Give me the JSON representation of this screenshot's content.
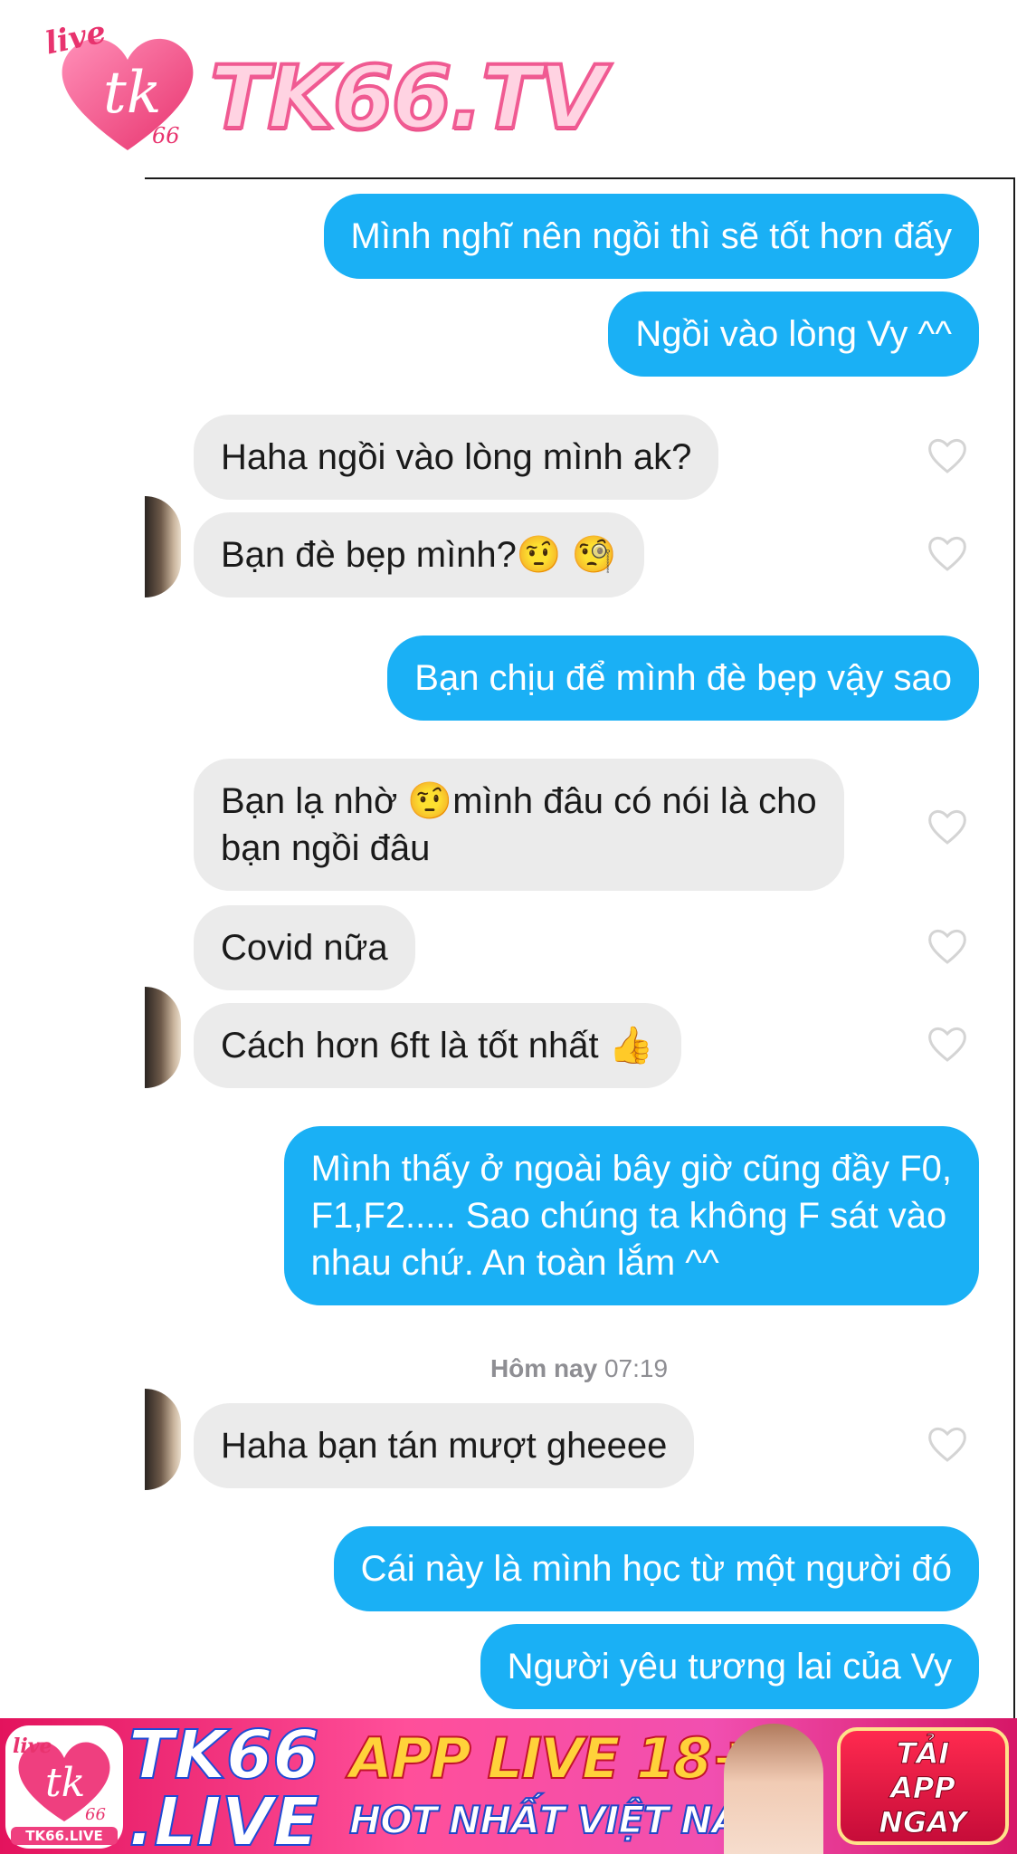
{
  "watermark": {
    "logo_live": "live",
    "logo_mark": "tk",
    "logo_number": "66",
    "brand": "TK66.TV"
  },
  "messages": [
    {
      "id": "m1",
      "side": "out",
      "text": "Mình nghĩ nên ngồi thì sẽ tốt hơn đấy"
    },
    {
      "id": "m2",
      "side": "out",
      "text": "Ngồi vào lòng Vy ^^"
    },
    {
      "id": "m3",
      "side": "in",
      "text": "Haha ngồi vào lòng mình ak?"
    },
    {
      "id": "m4",
      "side": "in",
      "text": "Bạn đè bẹp mình?",
      "emoji": "🤨 🧐"
    },
    {
      "id": "m5",
      "side": "out",
      "text": "Bạn chịu để mình đè bẹp vậy sao"
    },
    {
      "id": "m6",
      "side": "in",
      "line1_before": "Bạn lạ nhờ ",
      "emoji": "🤨",
      "line1_after": "mình đâu có nói là cho",
      "line2": "bạn ngồi đâu"
    },
    {
      "id": "m7",
      "side": "in",
      "text": "Covid nữa"
    },
    {
      "id": "m8",
      "side": "in",
      "text": "Cách hơn 6ft là tốt nhất ",
      "emoji": "👍"
    },
    {
      "id": "m9",
      "side": "out",
      "lines": [
        "Mình thấy ở ngoài bây giờ cũng đầy F0,",
        "F1,F2..... Sao chúng ta không F sát vào",
        "nhau chứ. An toàn lắm ^^"
      ]
    },
    {
      "id": "m10",
      "side": "in",
      "text": "Haha bạn tán mượt gheeee"
    },
    {
      "id": "m11",
      "side": "out",
      "text": "Cái này là mình học từ một người đó"
    },
    {
      "id": "m12",
      "side": "out",
      "text": "Người yêu tương lai của Vy"
    }
  ],
  "timestamp": {
    "day": "Hôm nay",
    "time": "07:19"
  },
  "icons": {
    "like": "heart-outline-icon",
    "avatar": "contact-avatar"
  },
  "colors": {
    "outgoing": "#1ab0f5",
    "incoming": "#ebebeb",
    "timestamp": "#8e8e93"
  },
  "banner": {
    "logo_live": "live",
    "logo_mark": "tk",
    "logo_number": "66",
    "logo_caption": "TK66.LIVE",
    "brand_line1": "TK66",
    "brand_line2": ".LIVE",
    "headline": "APP LIVE 18+",
    "subline": "HOT NHẤT VIỆT NAM",
    "cta_line1": "TẢI",
    "cta_line2": "APP",
    "cta_line3": "NGAY"
  }
}
